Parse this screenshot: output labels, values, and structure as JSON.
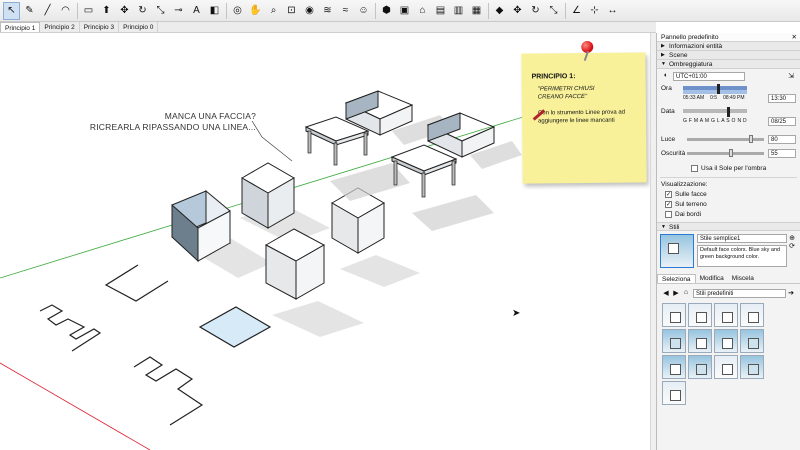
{
  "toolbar": {
    "tools": [
      {
        "name": "select-tool-icon",
        "glyph": "↖",
        "selected": true
      },
      {
        "name": "eraser-icon",
        "glyph": "✎"
      },
      {
        "name": "line-tool-icon",
        "glyph": "╱"
      },
      {
        "name": "arc-tool-icon",
        "glyph": "◠"
      },
      {
        "name": "rectangle-tool-icon",
        "glyph": "▭"
      },
      {
        "name": "push-pull-icon",
        "glyph": "⬆"
      },
      {
        "name": "move-icon",
        "glyph": "✥"
      },
      {
        "name": "rotate-icon",
        "glyph": "↻"
      },
      {
        "name": "scale-icon",
        "glyph": "⤡"
      },
      {
        "name": "tape-measure-icon",
        "glyph": "⊸"
      },
      {
        "name": "text-icon",
        "glyph": "A"
      },
      {
        "name": "paint-bucket-icon",
        "glyph": "◧"
      },
      {
        "name": "orbit-icon",
        "glyph": "◎"
      },
      {
        "name": "pan-icon",
        "glyph": "✋"
      },
      {
        "name": "zoom-icon",
        "glyph": "⌕"
      },
      {
        "name": "zoom-extents-icon",
        "glyph": "⊡"
      },
      {
        "name": "sandbox-icon",
        "glyph": "◉"
      },
      {
        "name": "layers-icon",
        "glyph": "≋"
      },
      {
        "name": "styles-icon",
        "glyph": "≈"
      },
      {
        "name": "geolocation-icon",
        "glyph": "☺"
      },
      {
        "name": "iso-view-icon",
        "glyph": "⬢"
      },
      {
        "name": "top-view-icon",
        "glyph": "▣"
      },
      {
        "name": "front-view-icon",
        "glyph": "⌂"
      },
      {
        "name": "right-view-icon",
        "glyph": "▤"
      },
      {
        "name": "back-view-icon",
        "glyph": "▥"
      },
      {
        "name": "left-view-icon",
        "glyph": "▦"
      },
      {
        "name": "solid-tools-icon",
        "glyph": "◆"
      },
      {
        "name": "follow-me-icon",
        "glyph": "✥"
      },
      {
        "name": "offset-icon",
        "glyph": "↻"
      },
      {
        "name": "outer-shell-icon",
        "glyph": "⤡"
      },
      {
        "name": "protractor-icon",
        "glyph": "∠"
      },
      {
        "name": "axes-icon",
        "glyph": "⊹"
      },
      {
        "name": "dimension-icon",
        "glyph": "↔"
      }
    ]
  },
  "scene_tabs": [
    "Principio 1",
    "Principio 2",
    "Principio 3",
    "Principio 0"
  ],
  "viewport": {
    "callout_line1": "MANCA UNA FACCIA?",
    "callout_line2": "RICREARLA RIPASSANDO UNA LINEA...",
    "sticky": {
      "title": "PRINCIPIO 1:",
      "quote_line1": "\"PERIMETRI CHIUSI",
      "quote_line2": "CREANO FACCE\"",
      "body_line1": "Con lo strumento Linee prova ad",
      "body_line2": "aggiungere le linee mancanti"
    }
  },
  "tray": {
    "title": "Pannello predefinito",
    "sections": {
      "info": "Informazioni entità",
      "scenes": "Scene",
      "shadows": "Ombreggiatura",
      "styles": "Stili"
    },
    "shadow": {
      "timezone": "UTC+01:00",
      "time_label": "Ora",
      "time_start": "05:33 AM",
      "time_noon": "0:5",
      "time_end": "08:49 PM",
      "time_value": "13:30",
      "date_label": "Data",
      "months": "G F M A M G L A S O N D",
      "date_value": "08/25",
      "light_label": "Luce",
      "light_value": "80",
      "light_fraction": 0.8,
      "dark_label": "Oscurità",
      "dark_value": "55",
      "dark_fraction": 0.55,
      "use_sun": "Usa il Sole per l'ombra",
      "display_heading": "Visualizzazione:",
      "on_faces": "Sulle facce",
      "on_ground": "Sul terreno",
      "from_edges": "Dai bordi"
    },
    "styles": {
      "style_name": "Stile semplice1",
      "style_desc": "Default face colors. Blue sky and green background color.",
      "tab_select": "Seleziona",
      "tab_edit": "Modifica",
      "tab_mix": "Miscela",
      "collection": "Stili predefiniti"
    }
  }
}
